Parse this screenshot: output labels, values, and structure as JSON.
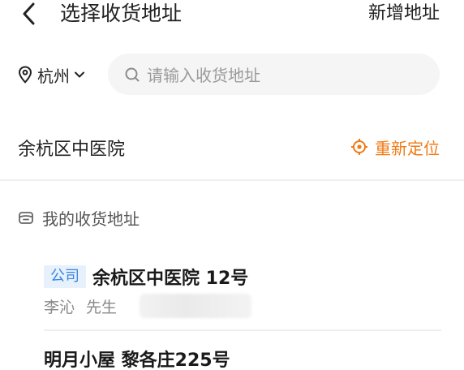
{
  "header": {
    "title": "选择收货地址",
    "new_address_label": "新增地址",
    "back_icon": "chevron-left-icon"
  },
  "search": {
    "city": "杭州",
    "placeholder": "请输入收货地址",
    "city_icon": "location-pin-icon",
    "search_icon": "search-icon"
  },
  "current_location": {
    "name": "余杭区中医院",
    "relocate_label": "重新定位",
    "accent_color": "#f07a14"
  },
  "my_addresses": {
    "title": "我的收货地址",
    "items": [
      {
        "tag": "公司",
        "title": "余杭区中医院 12号",
        "contact_name": "李沁",
        "contact_title": "先生",
        "phone": ""
      },
      {
        "title": "明月小屋 黎各庄225号"
      }
    ]
  },
  "colors": {
    "tag_bg": "#e6f1fc",
    "tag_text": "#3a86e0",
    "search_bg": "#f5f5f5"
  }
}
